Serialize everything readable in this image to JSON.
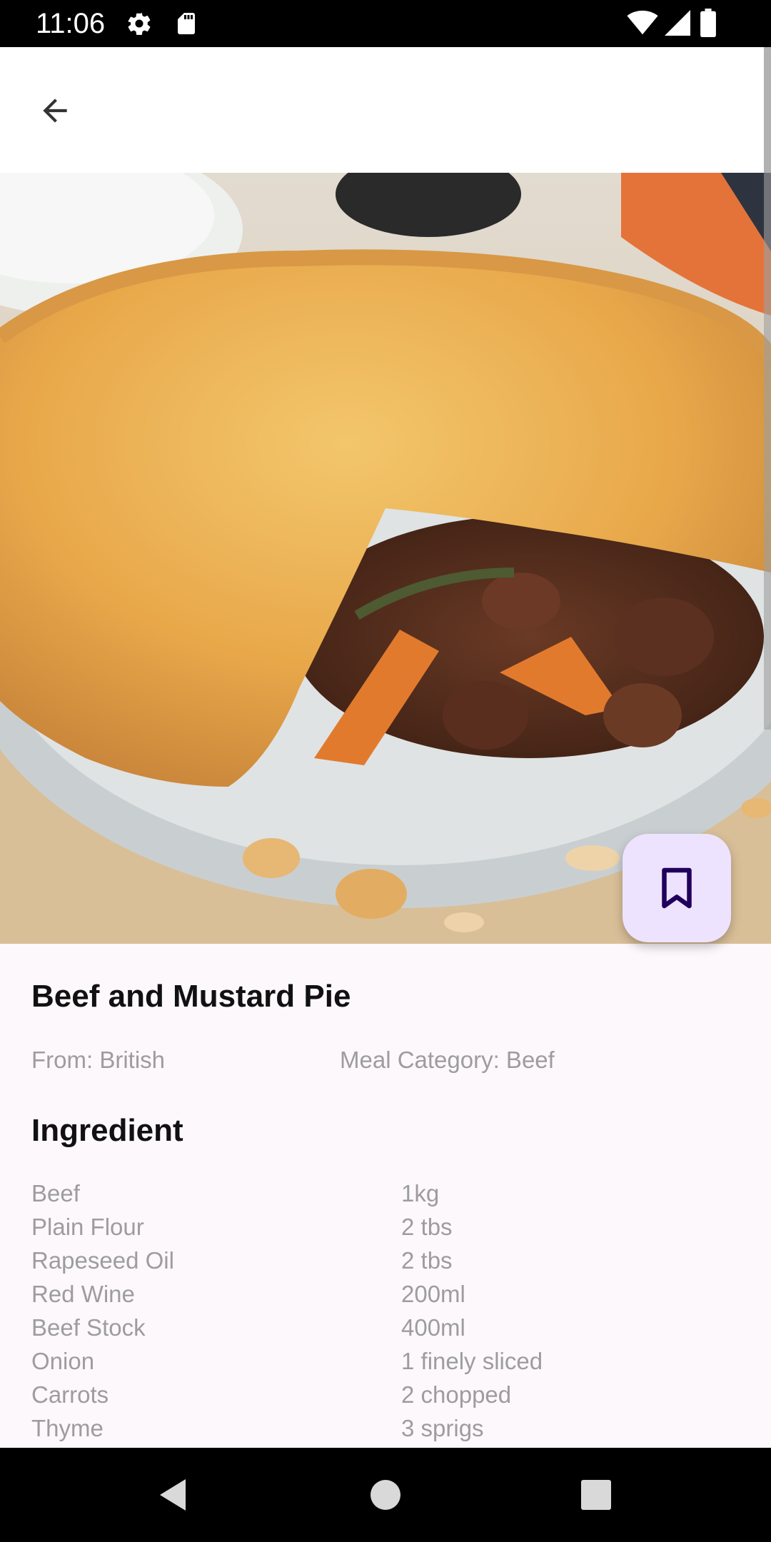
{
  "status_bar": {
    "time": "11:06",
    "icons": [
      "gear-icon",
      "sd-card-icon",
      "wifi-icon",
      "signal-icon",
      "battery-icon"
    ]
  },
  "top_bar": {
    "back_icon": "arrow-left-icon"
  },
  "fab": {
    "icon": "bookmark-icon",
    "color": "#ede3fe"
  },
  "meal": {
    "title": "Beef and Mustard Pie",
    "origin": "From: British",
    "category": "Meal Category: Beef"
  },
  "ingredients_section": {
    "title": "Ingredient",
    "items": [
      {
        "name": "Beef",
        "measure": "1kg"
      },
      {
        "name": "Plain Flour",
        "measure": "2 tbs"
      },
      {
        "name": "Rapeseed Oil",
        "measure": "2 tbs"
      },
      {
        "name": "Red Wine",
        "measure": "200ml"
      },
      {
        "name": "Beef Stock",
        "measure": "400ml"
      },
      {
        "name": "Onion",
        "measure": "1 finely sliced"
      },
      {
        "name": "Carrots",
        "measure": "2 chopped"
      },
      {
        "name": "Thyme",
        "measure": "3 sprigs"
      }
    ]
  },
  "nav_bar": {
    "icons": [
      "nav-back-icon",
      "nav-home-icon",
      "nav-recents-icon"
    ]
  },
  "colors": {
    "background": "#fdf8fc",
    "secondary_text": "#9d9d9d",
    "fab_background": "#ede3fe",
    "fab_icon": "#21005d"
  }
}
